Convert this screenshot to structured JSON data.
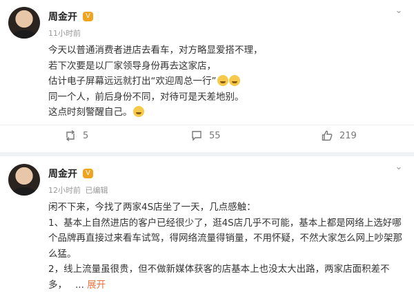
{
  "posts": [
    {
      "author": "周金开",
      "badge": "V",
      "time": "11小时前",
      "edited": "",
      "lines": [
        "今天以普通消费者进店去看车，对方略显爱搭不理，",
        "若下次要是以厂家领导身份再去这家店，",
        "估计电子屏幕远远就打出“欢迎周总一行”",
        "同一个人，前后身份不同，对待可是天差地别。",
        "这点时刻警醒自己。"
      ],
      "reposts": "5",
      "comments": "55",
      "likes": "219"
    },
    {
      "author": "周金开",
      "badge": "V",
      "time": "12小时前",
      "edited": "已编辑",
      "paragraphs": [
        "闲不下来，今找了两家4S店坐了一天，几点感触：",
        "1、基本上自然进店的客户已经很少了，逛4S店几乎不可能，基本上都是网络上选好哪个品牌再直接过来看车试驾，得网络流量得销量，不用怀疑，不然大家怎么网上吵架那么猛。",
        "2，线上流量虽很贵，但不做新媒体获客的店基本上也没太大出路，两家店面积差不多，"
      ],
      "ellipsis": "...",
      "expand": "展开"
    }
  ],
  "colors": {
    "accent": "#eb7340",
    "badge": "#f0a31e",
    "muted": "#999999"
  },
  "icons": {
    "more": "chevron-down-icon",
    "repost": "repost-icon",
    "comment": "comment-icon",
    "like": "like-icon"
  }
}
